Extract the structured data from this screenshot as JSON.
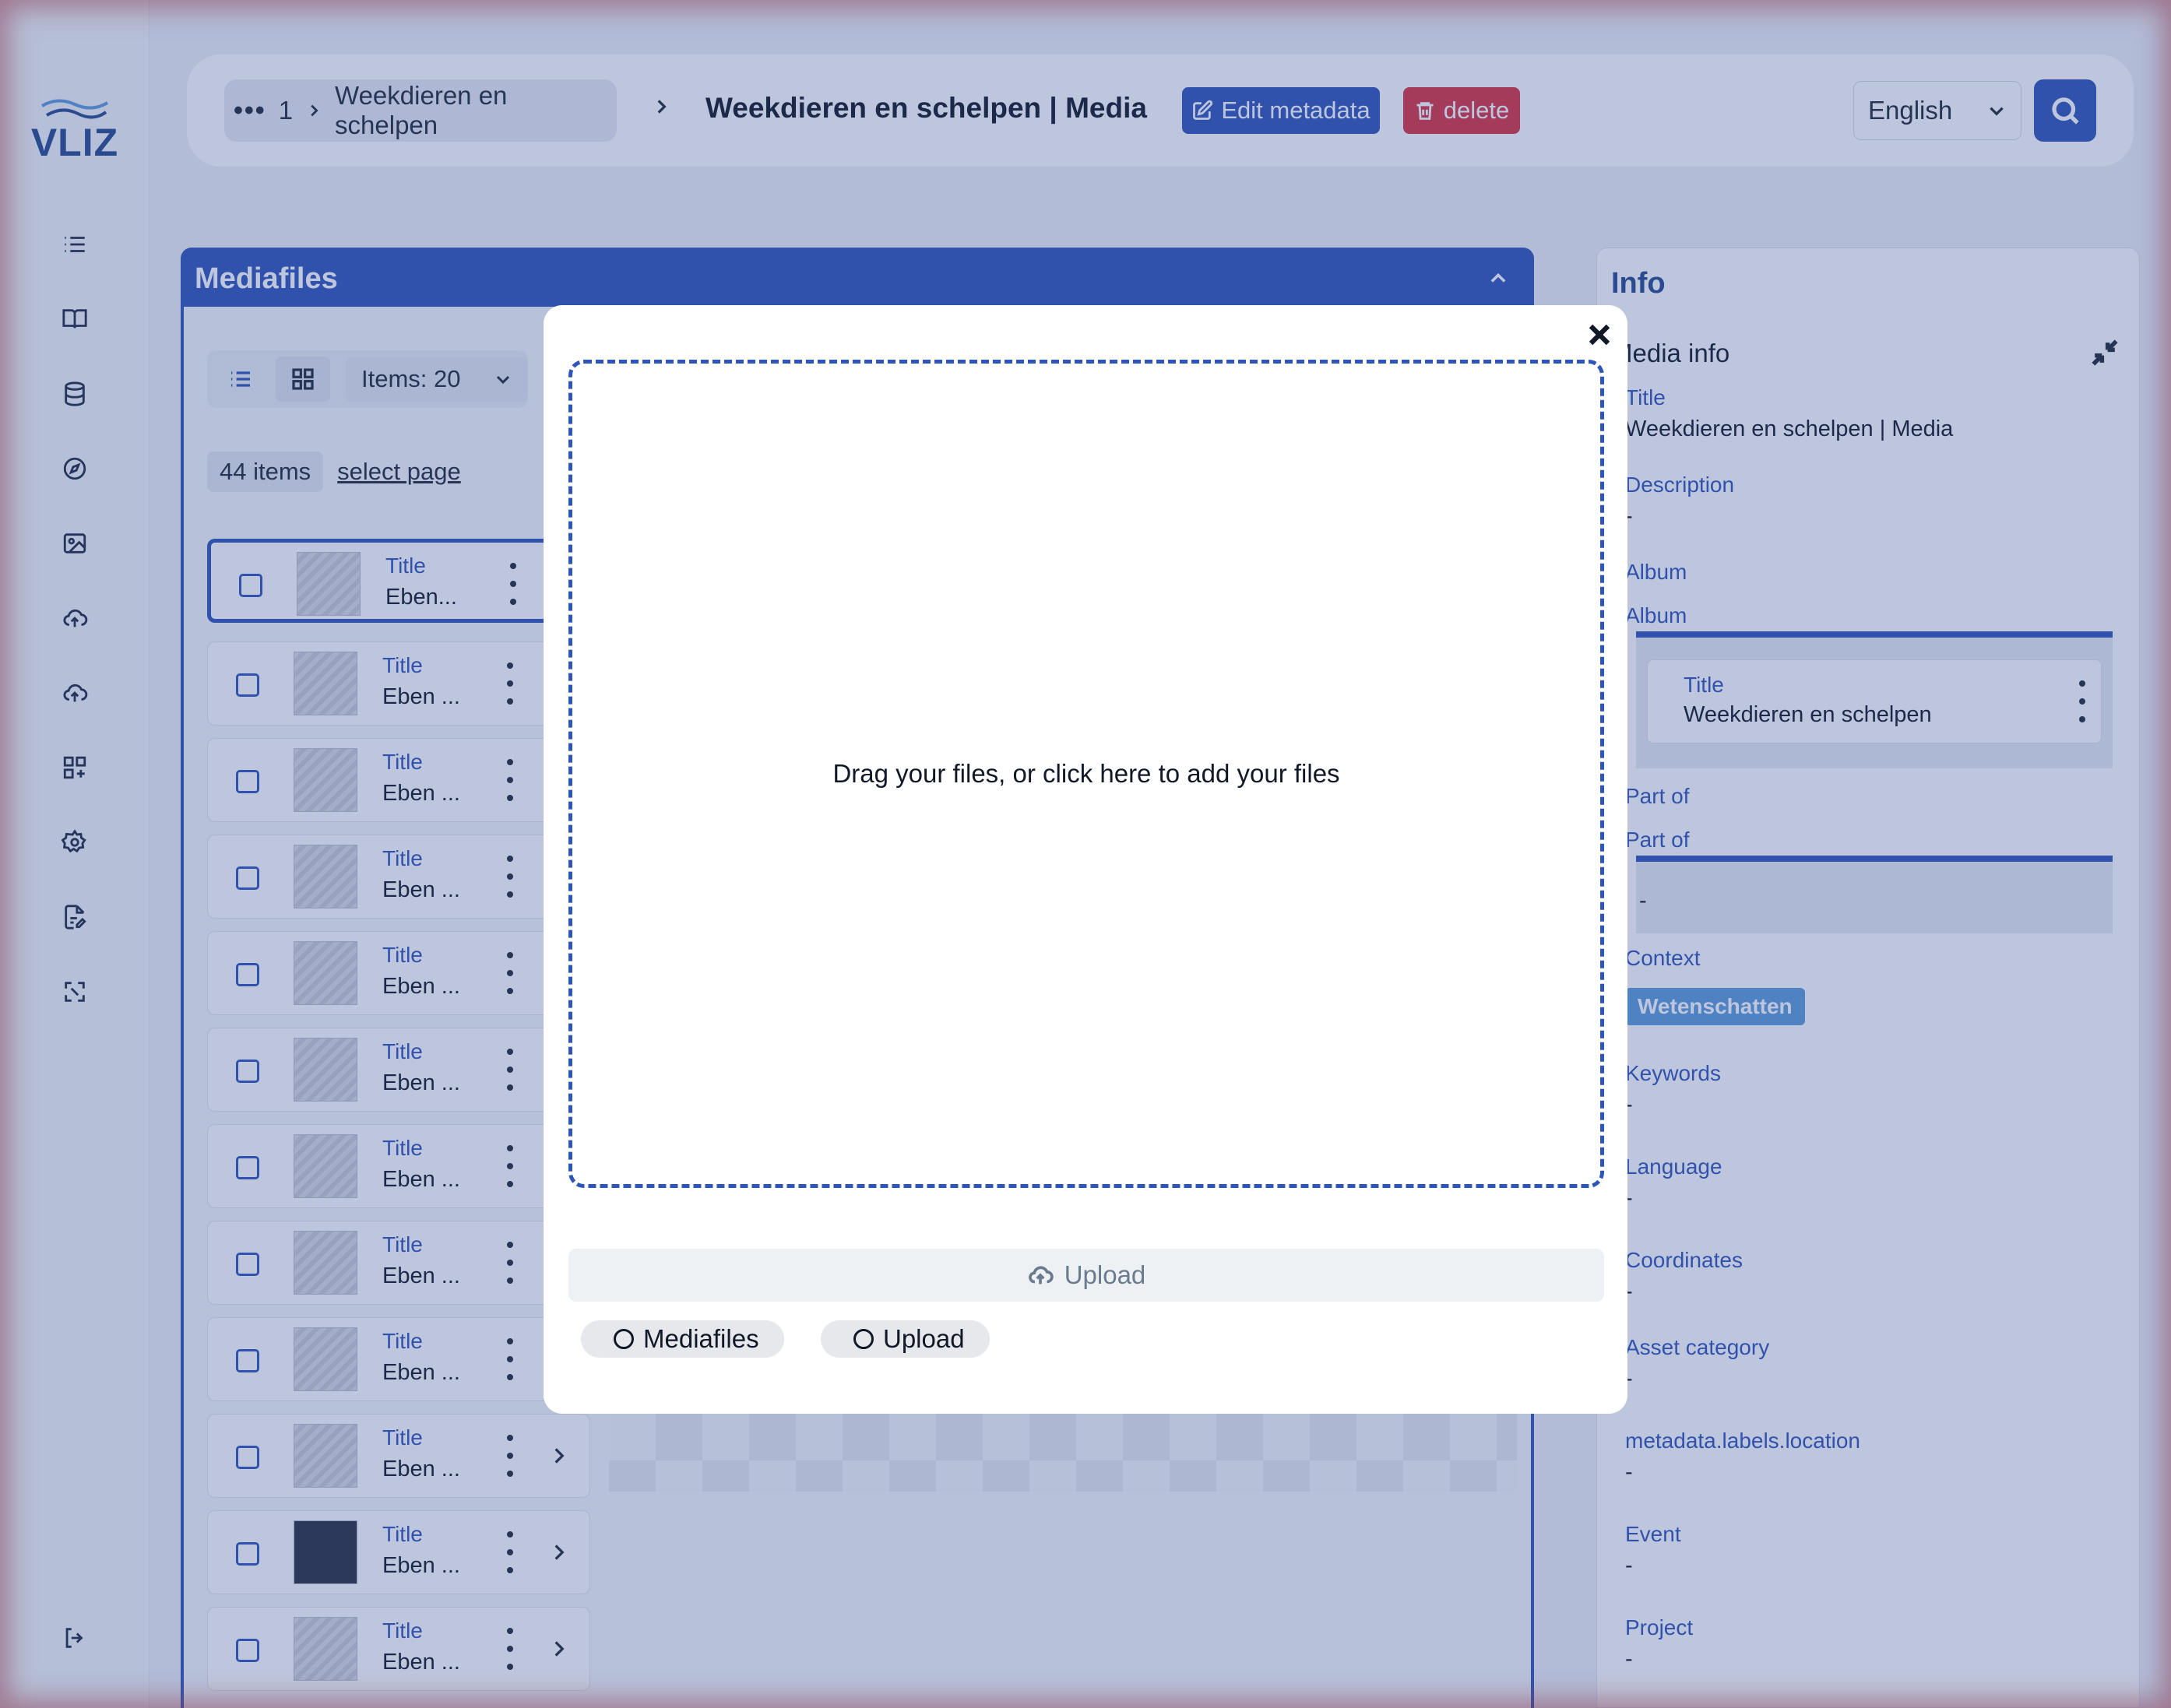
{
  "brand": {
    "logo_text": "VLIZ"
  },
  "header": {
    "crumb_ellipsis": "•••",
    "crumb_index": "1",
    "crumb_parent": "Weekdieren en schelpen",
    "crumb_current": "Weekdieren en schelpen | Media",
    "edit_label": "Edit metadata",
    "delete_label": "delete",
    "language": "English"
  },
  "media": {
    "title": "Mediafiles",
    "items_label": "Items: 20",
    "count_label": "44 items",
    "select_page_label": "select page",
    "rows": [
      {
        "label": "Title",
        "value": "Eben..."
      },
      {
        "label": "Title",
        "value": "Eben ..."
      },
      {
        "label": "Title",
        "value": "Eben ..."
      },
      {
        "label": "Title",
        "value": "Eben ..."
      },
      {
        "label": "Title",
        "value": "Eben ..."
      },
      {
        "label": "Title",
        "value": "Eben ..."
      },
      {
        "label": "Title",
        "value": "Eben ..."
      },
      {
        "label": "Title",
        "value": "Eben ..."
      },
      {
        "label": "Title",
        "value": "Eben ..."
      },
      {
        "label": "Title",
        "value": "Eben ..."
      },
      {
        "label": "Title",
        "value": "Eben ..."
      },
      {
        "label": "Title",
        "value": "Eben ..."
      }
    ]
  },
  "info": {
    "title": "Info",
    "subtitle": "Media info",
    "title_label": "Title",
    "title_value": "Weekdieren en schelpen | Media",
    "description_label": "Description",
    "description_value": "-",
    "album_label": "Album",
    "album_sublabel": "Album",
    "album_card_label": "Title",
    "album_card_value": "Weekdieren en schelpen",
    "partof_label": "Part of",
    "partof_sublabel": "Part of",
    "partof_value": "-",
    "context_label": "Context",
    "context_value": "Wetenschatten",
    "keywords_label": "Keywords",
    "keywords_value": "-",
    "language_label": "Language",
    "language_value": "-",
    "coordinates_label": "Coordinates",
    "coordinates_value": "-",
    "asset_label": "Asset category",
    "asset_value": "-",
    "location_label": "metadata.labels.location",
    "location_value": "-",
    "event_label": "Event",
    "event_value": "-",
    "project_label": "Project",
    "project_value": "-"
  },
  "modal": {
    "dropzone_text": "Drag your files, or click here to add your files",
    "upload_label": "Upload",
    "step_mediafiles": "Mediafiles",
    "step_upload": "Upload"
  },
  "colors": {
    "accent": "#2e55b8",
    "danger": "#d9333f",
    "badge": "#5b9bd8"
  }
}
